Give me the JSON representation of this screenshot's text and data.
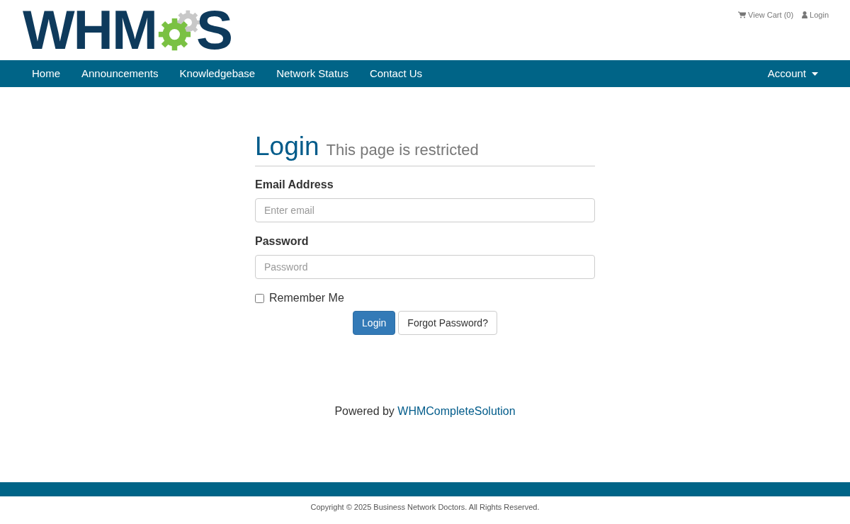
{
  "logo": {
    "before": "WHM",
    "after": "S"
  },
  "top_links": [
    {
      "kind": "cart",
      "label": "View Cart (0)"
    },
    {
      "kind": "user",
      "label": "Login"
    }
  ],
  "nav": {
    "items": [
      {
        "label": "Home"
      },
      {
        "label": "Announcements"
      },
      {
        "label": "Knowledgebase"
      },
      {
        "label": "Network Status"
      },
      {
        "label": "Contact Us"
      }
    ],
    "account": {
      "label": "Account",
      "expanded": false
    }
  },
  "login": {
    "title": "Login",
    "subtitle": "This page is restricted",
    "fields": [
      {
        "label": "Email Address",
        "placeholder": "Enter email"
      },
      {
        "label": "Password",
        "placeholder": "Password"
      }
    ],
    "remember": {
      "label": "Remember Me",
      "checked": false
    },
    "buttons": [
      {
        "kind": "primary",
        "label": "Login"
      },
      {
        "kind": "default",
        "label": "Forgot Password?"
      }
    ]
  },
  "powered_by": {
    "text": "Powered by",
    "link": "WHMCompleteSolution"
  },
  "copyright": "Copyright © 2025 Business Network Doctors. All Rights Reserved."
}
